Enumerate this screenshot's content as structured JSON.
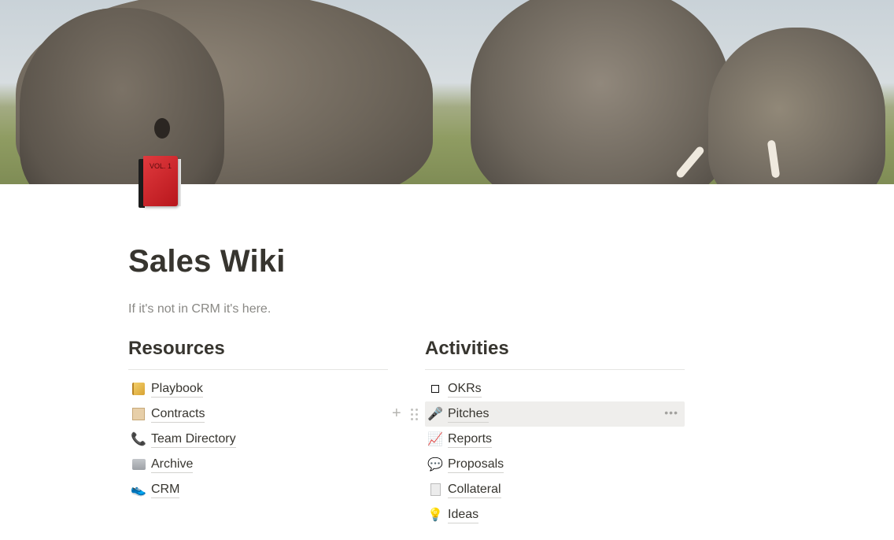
{
  "cover": {
    "description": "elephants-photo"
  },
  "page": {
    "icon": "red-book-icon",
    "icon_text": "VOL. 1",
    "title": "Sales Wiki",
    "subtitle": "If it's not in CRM it's here."
  },
  "columns": [
    {
      "heading": "Resources",
      "items": [
        {
          "icon": "ledger-icon",
          "label": "Playbook"
        },
        {
          "icon": "scroll-icon",
          "label": "Contracts"
        },
        {
          "icon": "phone-icon",
          "label": "Team Directory",
          "glyph": "📞"
        },
        {
          "icon": "folder-icon",
          "label": "Archive"
        },
        {
          "icon": "shoe-icon",
          "label": "CRM",
          "glyph": "👟"
        }
      ]
    },
    {
      "heading": "Activities",
      "items": [
        {
          "icon": "checkbox-icon",
          "label": "OKRs"
        },
        {
          "icon": "microphone-icon",
          "label": "Pitches",
          "glyph": "🎤",
          "hovered": true,
          "more": "•••"
        },
        {
          "icon": "chart-increasing-icon",
          "label": "Reports",
          "glyph": "📈"
        },
        {
          "icon": "speech-bubble-icon",
          "label": "Proposals",
          "glyph": "💬"
        },
        {
          "icon": "document-icon",
          "label": "Collateral"
        },
        {
          "icon": "lightbulb-icon",
          "label": "Ideas",
          "glyph": "💡"
        }
      ]
    }
  ],
  "block_handles": {
    "add": "+",
    "drag": "drag-handle"
  }
}
